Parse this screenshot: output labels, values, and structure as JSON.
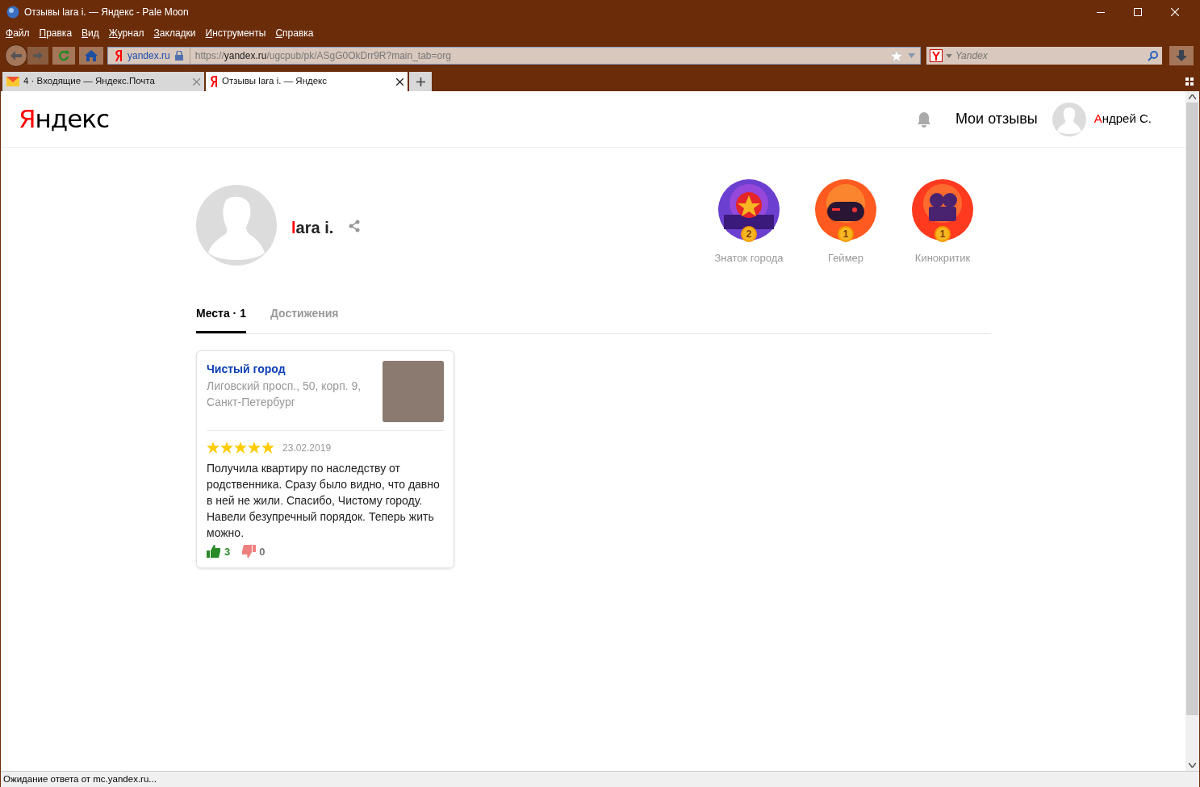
{
  "window": {
    "title": "Отзывы lara i. — Яндекс - Pale Moon"
  },
  "menu": [
    "Файл",
    "Правка",
    "Вид",
    "Журнал",
    "Закладки",
    "Инструменты",
    "Справка"
  ],
  "toolbar": {
    "site": "yandex.ru",
    "url_prefix": "https://",
    "url_host": "yandex.ru",
    "url_path": "/ugcpub/pk/ASgG0OkDrr9R?main_tab=org",
    "search_placeholder": "Yandex"
  },
  "tabs": [
    {
      "label": "4 · Входящие — Яндекс.Почта",
      "kind": "mail",
      "selected": false
    },
    {
      "label": "Отзывы lara i. — Яндекс",
      "kind": "yandex",
      "selected": true
    }
  ],
  "header": {
    "logo": "Яндекс",
    "my_reviews": "Мои отзывы",
    "user": "Андрей С."
  },
  "profile": {
    "name": "lara i."
  },
  "achievements": [
    {
      "kind": "city",
      "count": "2",
      "label": "Знаток города"
    },
    {
      "kind": "gamer",
      "count": "1",
      "label": "Геймер"
    },
    {
      "kind": "film",
      "count": "1",
      "label": "Кинокритик"
    }
  ],
  "content_tabs": [
    {
      "label": "Места · 1",
      "selected": true
    },
    {
      "label": "Достижения",
      "selected": false
    }
  ],
  "reviews": [
    {
      "org": "Чистый город",
      "address": "Лиговский просп., 50, корп. 9, Санкт-Петербург",
      "stars": 5,
      "date": "23.02.2019",
      "text": "Получила квартиру по наследству от родственника. Сразу было видно, что давно в ней не жили. Спасибо, Чистому городу. Навели безупречный порядок. Теперь жить можно.",
      "likes": "3",
      "dislikes": "0"
    }
  ],
  "status_bar": "Ожидание ответа от mc.yandex.ru..."
}
